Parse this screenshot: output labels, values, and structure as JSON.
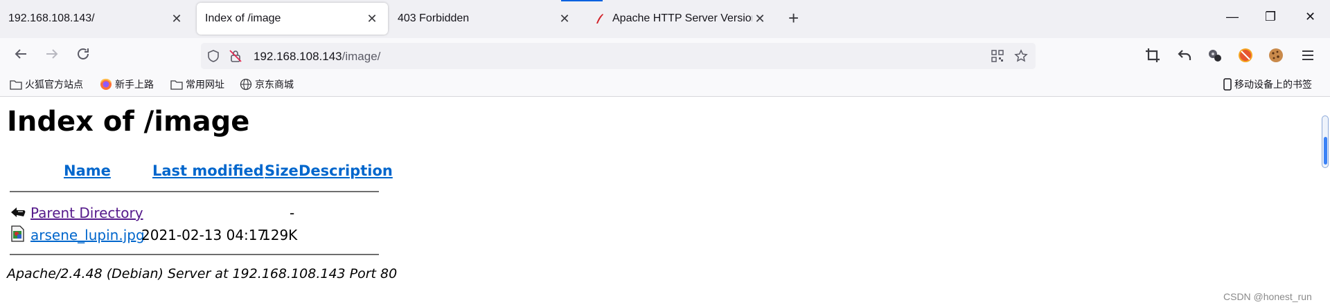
{
  "browser": {
    "tabs": [
      {
        "title": "192.168.108.143/",
        "close": "✕",
        "active": false
      },
      {
        "title": "Index of /image",
        "close": "✕",
        "active": true
      },
      {
        "title": "403 Forbidden",
        "close": "✕",
        "active": false
      },
      {
        "title": "Apache HTTP Server Version",
        "close": "✕",
        "active": false
      }
    ],
    "new_tab": "+",
    "window_controls": {
      "minimize": "—",
      "restore": "❐",
      "close": "✕"
    }
  },
  "navbar": {
    "url_host": "192.168.108.143",
    "url_path": "/image/",
    "icons": [
      "back-icon",
      "forward-icon",
      "reload-icon",
      "shield-icon",
      "insecure-lock-icon",
      "qr-code-icon",
      "bookmark-star-icon",
      "screenshot-crop-icon",
      "undo-icon",
      "extensions-icon",
      "cookie-blocker-icon",
      "cookie-icon",
      "menu-icon"
    ]
  },
  "bookmarks": {
    "items": [
      "火狐官方站点",
      "新手上路",
      "常用网址",
      "京东商城"
    ],
    "mobile": "移动设备上的书签"
  },
  "page": {
    "heading": "Index of /image",
    "columns": {
      "name": "Name",
      "modified": "Last modified",
      "size": "Size",
      "description": "Description"
    },
    "rows": [
      {
        "name": "Parent Directory",
        "modified": "",
        "size": "-",
        "icon": "back-folder-icon",
        "link_color": "#551a8b"
      },
      {
        "name": "arsene_lupin.jpg",
        "modified": "2021-02-13 04:17",
        "size": "129K",
        "icon": "image-file-icon",
        "link_color": "#0066cc"
      }
    ],
    "address": "Apache/2.4.48 (Debian) Server at 192.168.108.143 Port 80"
  },
  "watermark": "CSDN @honest_run",
  "colors": {
    "accent": "#0061e0",
    "link": "#0066cc",
    "visited": "#551a8b"
  }
}
